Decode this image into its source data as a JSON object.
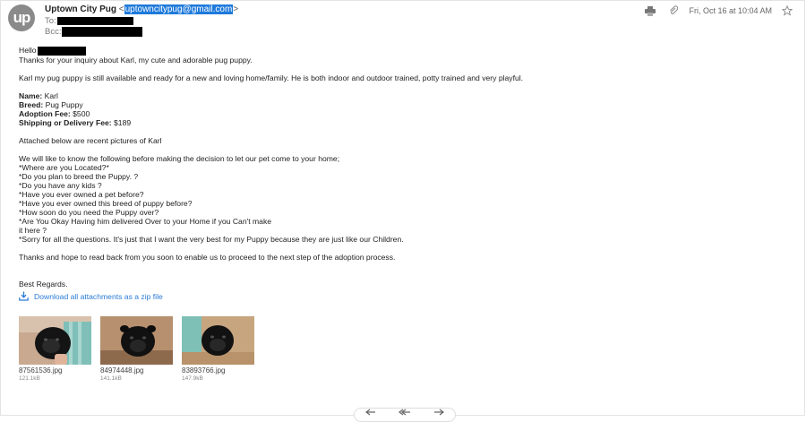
{
  "header": {
    "avatar_text": "up",
    "sender_name": "Uptown City Pug",
    "sender_email_prefix": "<",
    "sender_email": "uptowncitypug@gmail.com",
    "sender_email_suffix": ">",
    "to_label": "To:",
    "bcc_label": "Bcc:",
    "date": "Fri, Oct 16 at 10:04 AM",
    "icons": [
      "print-icon",
      "attachment-icon",
      "star-icon"
    ]
  },
  "body": {
    "greeting": "Hello",
    "intro": "Thanks for your inquiry about Karl, my cute and adorable pug puppy.",
    "para1": "Karl my pug puppy is still available and ready for a new and loving home/family. He is both indoor and outdoor trained, potty trained and very playful.",
    "details": [
      {
        "label": "Name:",
        "value": " Karl"
      },
      {
        "label": "Breed:",
        "value": " Pug Puppy"
      },
      {
        "label": "Adoption Fee:",
        "value": " $500"
      },
      {
        "label": "Shipping or Delivery Fee:",
        "value": " $189"
      }
    ],
    "attached_note": "Attached below are recent pictures of Karl",
    "questions_intro": "We will like to know the following before making the decision to let our pet come to your home;",
    "questions": [
      "*Where are you Located?*",
      "*Do you plan to breed the Puppy. ?",
      "*Do you have any kids ?",
      "*Have you ever owned a pet before?",
      "*Have you ever owned this breed of puppy before?",
      "*How soon do you need the Puppy over?",
      "*Are You Okay Having him delivered Over to your Home if you Can't make",
      "it here ?",
      "*Sorry for all the questions. It's just that I want the very best for my Puppy because they are just like our Children."
    ],
    "closing": "Thanks and hope to read back from you soon to enable us to proceed to the next step of the adoption process.",
    "signoff": "Best Regards."
  },
  "download_all": "Download all attachments as a zip file",
  "attachments": [
    {
      "name": "87561536.jpg",
      "size": "121.1kB"
    },
    {
      "name": "84974448.jpg",
      "size": "141.1kB"
    },
    {
      "name": "83893766.jpg",
      "size": "147.9kB"
    }
  ],
  "colors": {
    "link": "#2a7bd6",
    "highlight": "#1f7adb"
  }
}
